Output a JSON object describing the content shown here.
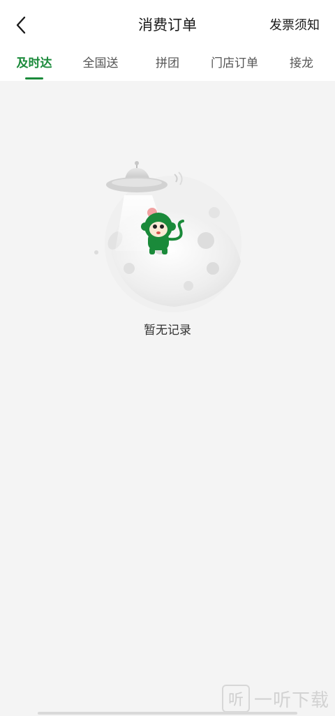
{
  "header": {
    "title": "消费订单",
    "invoice_link": "发票须知"
  },
  "tabs": [
    {
      "label": "及时达",
      "active": true
    },
    {
      "label": "全国送",
      "active": false
    },
    {
      "label": "拼团",
      "active": false
    },
    {
      "label": "门店订单",
      "active": false
    },
    {
      "label": "接龙",
      "active": false
    }
  ],
  "empty_state": {
    "message": "暂无记录"
  },
  "watermark": {
    "box_char": "听",
    "text": "一听下载"
  },
  "colors": {
    "accent": "#1a8a3a",
    "background": "#f4f4f4"
  },
  "icons": {
    "back": "chevron-left-icon"
  }
}
